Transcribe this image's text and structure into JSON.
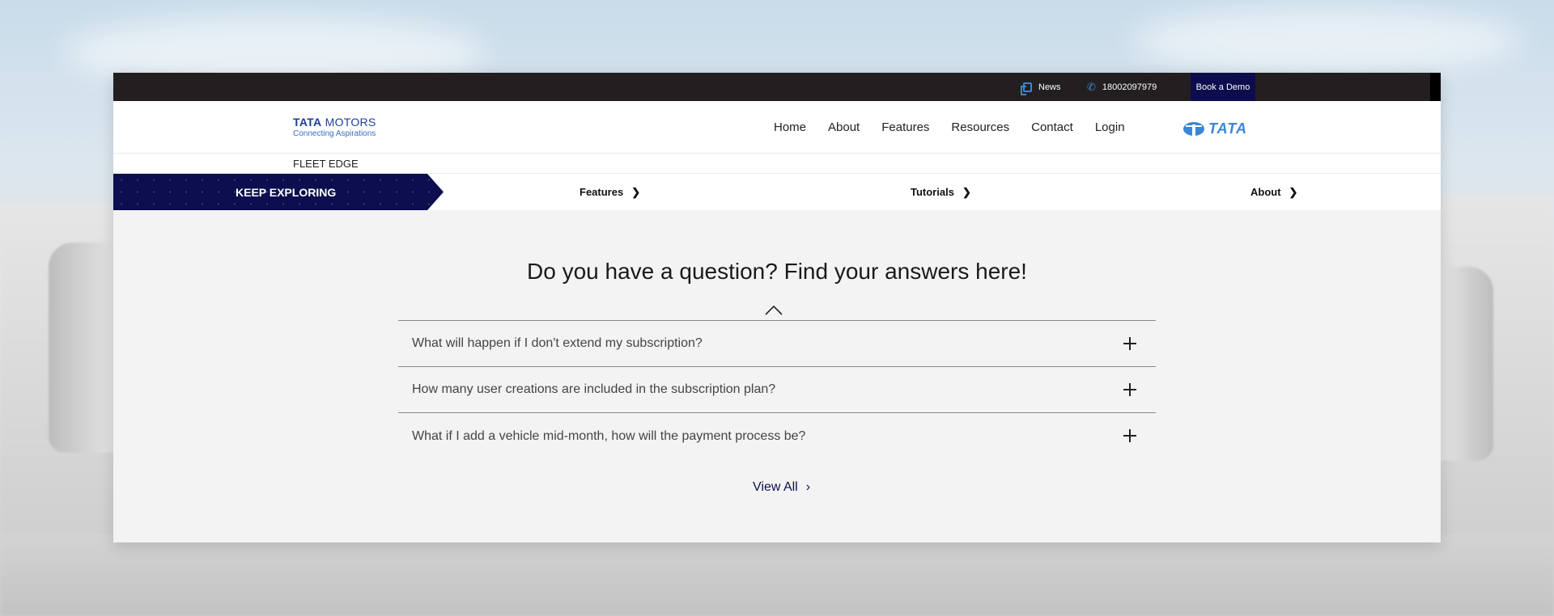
{
  "topbar": {
    "news_label": "News",
    "phone_number": "18002097979",
    "demo_label": "Book a Demo",
    "news_icon": "news-icon",
    "phone_icon": "phone-icon"
  },
  "brand": {
    "logo_bold": "TATA",
    "logo_rest": " MOTORS",
    "tagline": "Connecting Aspirations",
    "right_logo": "TATA",
    "product": "FLEET EDGE",
    "accent_color": "#3a86d6",
    "brand_navy": "#0d0e4f"
  },
  "nav": {
    "items": [
      "Home",
      "About",
      "Features",
      "Resources",
      "Contact",
      "Login"
    ]
  },
  "explore": {
    "label": "KEEP EXPLORING",
    "links": [
      "Features",
      "Tutorials",
      "About"
    ]
  },
  "faq": {
    "title": "Do you have a question? Find your answers here!",
    "questions": [
      "What will happen if I don't extend my subscription?",
      "How many user creations are included in the subscription plan?",
      "What if I add a vehicle mid-month, how will the payment process be?"
    ],
    "view_all": "View All"
  }
}
